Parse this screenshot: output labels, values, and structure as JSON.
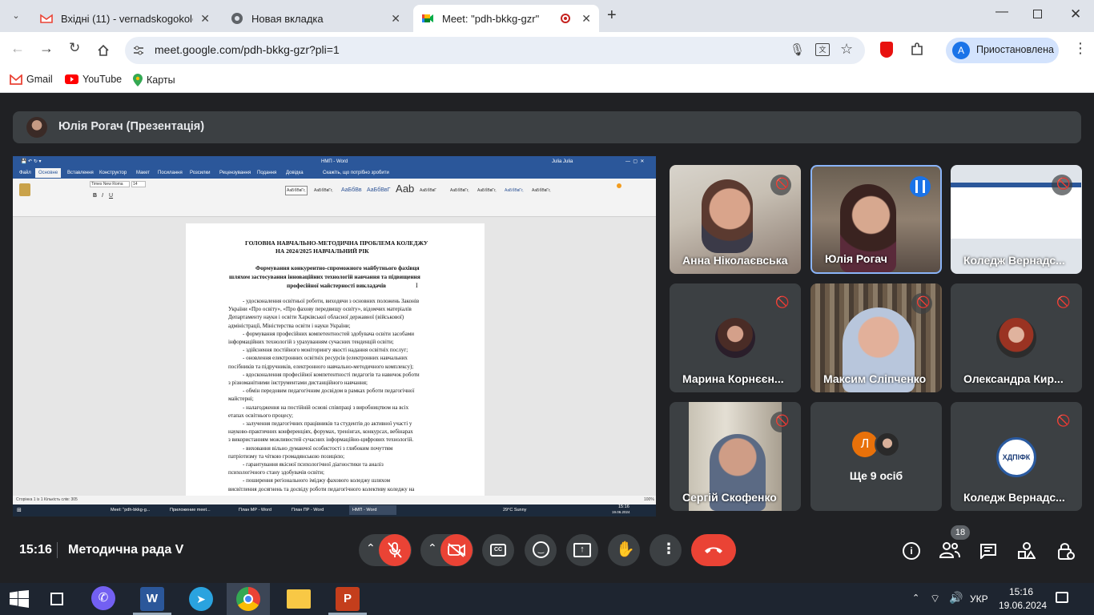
{
  "browser": {
    "tabs": [
      {
        "title": "Вхідні (11) - vernadskogokoled",
        "favicon": "gmail-icon"
      },
      {
        "title": "Новая вкладка",
        "favicon": "chrome-icon"
      },
      {
        "title": "Meet: \"pdh-bkkg-gzr\"",
        "favicon": "meet-icon",
        "active": true
      }
    ],
    "url": "meet.google.com/pdh-bkkg-gzr?pli=1",
    "profile_label": "Приостановлена",
    "profile_initial": "A",
    "bookmarks": [
      "Gmail",
      "YouTube",
      "Карты"
    ]
  },
  "meet": {
    "presenter": "Юлія Рогач (Презентація)",
    "participants": [
      {
        "name": "Анна Ніколаєвська",
        "muted": true
      },
      {
        "name": "Юлія Рогач",
        "muted": false,
        "speaking": true
      },
      {
        "name": "Коледж Вернадс...",
        "muted": true
      },
      {
        "name": "Марина Корнєєн...",
        "muted": true
      },
      {
        "name": "Максим Сліпченко",
        "muted": true
      },
      {
        "name": "Олександра Кир...",
        "muted": true
      },
      {
        "name": "Сергій Скофенко",
        "muted": true
      },
      {
        "name": "Ще 9 осіб",
        "initial": "Л"
      },
      {
        "name": "Коледж Вернадс...",
        "muted": true,
        "logo_text": "ХДПІФК"
      }
    ],
    "time": "15:16",
    "meeting_name": "Методична рада V",
    "people_count": "18",
    "colors": {
      "accent": "#8ab4f8",
      "end_call": "#ea4335",
      "bg": "#202124",
      "tile": "#3c4043"
    }
  },
  "word": {
    "title": "НМП - Word",
    "user": "Julia Julia",
    "tabs": [
      "Файл",
      "Основне",
      "Вставлення",
      "Конструктор",
      "Макет",
      "Посилання",
      "Розсилки",
      "Рецензування",
      "Подання",
      "Довідка",
      "Скажіть, що потрібно зробити"
    ],
    "font": "Times New Roma",
    "size": "14",
    "styles": [
      "АаБбВвГг,",
      "АаБбВвГг,",
      "АаБбВв",
      "АаБбВвГ",
      "Ааb",
      "АаБбВвГ",
      "АаБбВвГг,",
      "АаБбВвГг,",
      "АаБбВвГг,",
      "АаБбВвГг,"
    ],
    "doc": {
      "heading1": "ГОЛОВНА НАВЧАЛЬНО-МЕТОДИЧНА ПРОБЛЕМА КОЛЕДЖУ",
      "heading2": "НА 2024/2025 НАВЧАЛЬНИЙ РІК",
      "sub1": "Формування конкурентно-спроможного майбутнього фахівця",
      "sub2": "шляхом застосування інноваційних технологій навчання та підвищення",
      "sub3": "професійної майстерності викладачів",
      "lines": [
        "- удосконалення освітньої роботи, виходячи з основних положень Законів",
        "України «Про освіту», «Про фахову передвищу освіту», відомчих матеріалів",
        "Департаменту науки і освіти Харківської обласної державної (військової)",
        "адміністрації, Міністерства освіти і науки України;",
        "- формування професійних компетентностей здобувача освіти засобами",
        "інформаційних технологій з урахуванням сучасних тенденцій освіти;",
        "- здійснення постійного моніторингу якості надання освітніх послуг;",
        "- оновлення електронних освітніх ресурсів (електронних навчальних",
        "посібників та підручників, електронного навчально-методичного комплексу);",
        "- вдосконалення професійної компетентності педагогів та навичок роботи",
        "з різноманітними інструментами дистанційного навчання;",
        "- обмін передовим педагогічним досвідом в рамках роботи педагогічної",
        "майстерні;",
        "- налагодження на постійній основі співпраці з виробництвом на всіх",
        "етапах освітнього процесу;",
        "- залучення педагогічних працівників та студентів до активної участі у",
        "науково-практичних конференціях, форумах, тренінгах, конкурсах, вебінарах",
        "з використанням можливостей сучасних інформаційно-цифрових технологій.",
        "- виховання вільно думаючої особистості з глибоким почуттям",
        "патріотизму та чіткою громадянською позицією;",
        "- гарантування якісної психологічної діагностики та аналіз",
        "психологічного стану здобувачів освіти;",
        "- поширення регіонального іміджу фахового коледжу шляхом",
        "висвітлення досягнень та досвіду роботи педагогічного колективу коледжу на"
      ]
    },
    "status": "Сторінка 1 із 1   Кількість слів: 305",
    "taskbar": [
      "Meet: \"pdh-bkkg-g...",
      "Приложение meet...",
      "План МР - Word",
      "План ПР - Word",
      "НМП - Word"
    ],
    "weather": "29°C Sunny",
    "time": "15:16",
    "date": "19.06.2024",
    "zoom": "100%"
  },
  "windows": {
    "time": "15:16",
    "date": "19.06.2024",
    "lang": "УКР"
  }
}
